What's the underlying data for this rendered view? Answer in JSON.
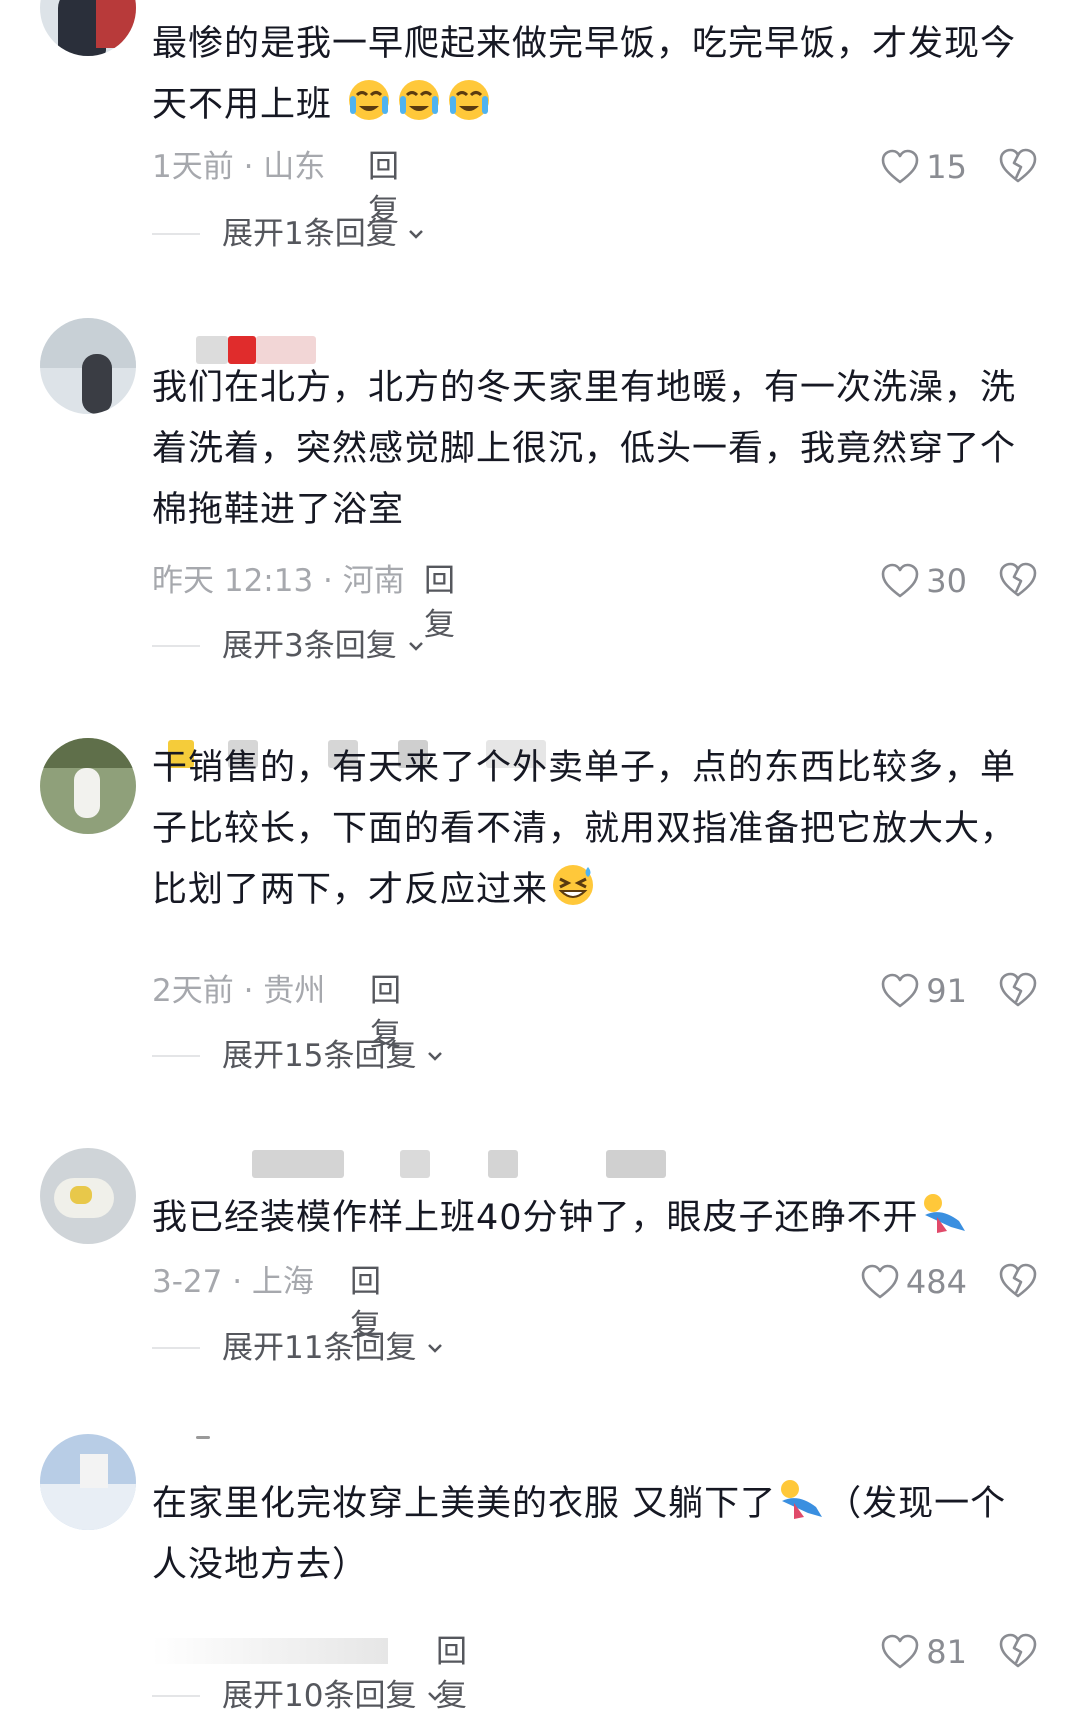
{
  "comments": [
    {
      "text": "最惨的是我一早爬起来做完早饭，吃完早饭，才发现今天不用上班",
      "emoji": "crying-face-emoji",
      "meta": "1天前 · 山东",
      "reply_label": "回复",
      "likes": "15",
      "expand": "展开1条回复"
    },
    {
      "text": "我们在北方，北方的冬天家里有地暖，有一次洗澡，洗着洗着，突然感觉脚上很沉，低头一看，我竟然穿了个棉拖鞋进了浴室",
      "meta": "昨天 12:13 · 河南",
      "reply_label": "回复",
      "likes": "30",
      "expand": "展开3条回复"
    },
    {
      "text": "干销售的，有天来了个外卖单子，点的东西比较多，单子比较长，下面的看不清，就用双指准备把它放大大，比划了两下，才反应过来",
      "emoji": "laughing-sweat-emoji",
      "meta": "2天前 · 贵州",
      "reply_label": "回复",
      "likes": "91",
      "expand": "展开15条回复"
    },
    {
      "text": "我已经装模作样上班40分钟了，眼皮子还睁不开",
      "emoji": "lying-down-emoji",
      "meta": "3-27 · 上海",
      "reply_label": "回复",
      "likes": "484",
      "expand": "展开11条回复"
    },
    {
      "text_part1": "在家里化完妆穿上美美的衣服 又躺下了",
      "text_part2": "（发现一个人没地方去）",
      "emoji": "lying-down-emoji",
      "reply_label": "回复",
      "likes": "81",
      "expand": "展开10条回复"
    }
  ],
  "colors": {
    "text": "#161823",
    "meta": "#a6a8ad",
    "reply": "#55575d",
    "like": "#8a8c92"
  }
}
